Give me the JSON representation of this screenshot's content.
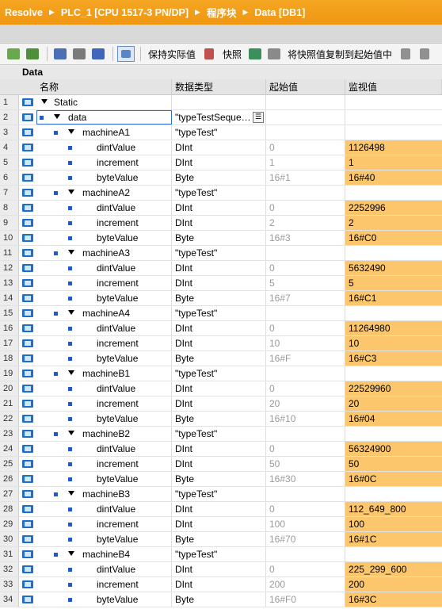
{
  "breadcrumb": [
    "Resolve",
    "PLC_1 [CPU 1517-3 PN/DP]",
    "程序块",
    "Data [DB1]"
  ],
  "toolbar": {
    "keep_actual": "保持实际值",
    "snapshot": "快照",
    "copy_snapshot": "将快照值复制到起始值中"
  },
  "block_title": "Data",
  "columns": {
    "name": "名称",
    "type": "数据类型",
    "start": "起始值",
    "monitor": "监视值"
  },
  "rows": [
    {
      "n": "1",
      "name": "Static",
      "type": "",
      "start": "",
      "monitor": ""
    },
    {
      "n": "2",
      "name": "data",
      "type": "\"typeTestSeque…",
      "start": "",
      "monitor": ""
    },
    {
      "n": "3",
      "name": "machineA1",
      "type": "\"typeTest\"",
      "start": "",
      "monitor": ""
    },
    {
      "n": "4",
      "name": "dintValue",
      "type": "DInt",
      "start": "0",
      "monitor": "1126498"
    },
    {
      "n": "5",
      "name": "increment",
      "type": "DInt",
      "start": "1",
      "monitor": "1"
    },
    {
      "n": "6",
      "name": "byteValue",
      "type": "Byte",
      "start": "16#1",
      "monitor": "16#40"
    },
    {
      "n": "7",
      "name": "machineA2",
      "type": "\"typeTest\"",
      "start": "",
      "monitor": ""
    },
    {
      "n": "8",
      "name": "dintValue",
      "type": "DInt",
      "start": "0",
      "monitor": "2252996"
    },
    {
      "n": "9",
      "name": "increment",
      "type": "DInt",
      "start": "2",
      "monitor": "2"
    },
    {
      "n": "10",
      "name": "byteValue",
      "type": "Byte",
      "start": "16#3",
      "monitor": "16#C0"
    },
    {
      "n": "11",
      "name": "machineA3",
      "type": "\"typeTest\"",
      "start": "",
      "monitor": ""
    },
    {
      "n": "12",
      "name": "dintValue",
      "type": "DInt",
      "start": "0",
      "monitor": "5632490"
    },
    {
      "n": "13",
      "name": "increment",
      "type": "DInt",
      "start": "5",
      "monitor": "5"
    },
    {
      "n": "14",
      "name": "byteValue",
      "type": "Byte",
      "start": "16#7",
      "monitor": "16#C1"
    },
    {
      "n": "15",
      "name": "machineA4",
      "type": "\"typeTest\"",
      "start": "",
      "monitor": ""
    },
    {
      "n": "16",
      "name": "dintValue",
      "type": "DInt",
      "start": "0",
      "monitor": "11264980"
    },
    {
      "n": "17",
      "name": "increment",
      "type": "DInt",
      "start": "10",
      "monitor": "10"
    },
    {
      "n": "18",
      "name": "byteValue",
      "type": "Byte",
      "start": "16#F",
      "monitor": "16#C3"
    },
    {
      "n": "19",
      "name": "machineB1",
      "type": "\"typeTest\"",
      "start": "",
      "monitor": ""
    },
    {
      "n": "20",
      "name": "dintValue",
      "type": "DInt",
      "start": "0",
      "monitor": "22529960"
    },
    {
      "n": "21",
      "name": "increment",
      "type": "DInt",
      "start": "20",
      "monitor": "20"
    },
    {
      "n": "22",
      "name": "byteValue",
      "type": "Byte",
      "start": "16#10",
      "monitor": "16#04"
    },
    {
      "n": "23",
      "name": "machineB2",
      "type": "\"typeTest\"",
      "start": "",
      "monitor": ""
    },
    {
      "n": "24",
      "name": "dintValue",
      "type": "DInt",
      "start": "0",
      "monitor": "56324900"
    },
    {
      "n": "25",
      "name": "increment",
      "type": "DInt",
      "start": "50",
      "monitor": "50"
    },
    {
      "n": "26",
      "name": "byteValue",
      "type": "Byte",
      "start": "16#30",
      "monitor": "16#0C"
    },
    {
      "n": "27",
      "name": "machineB3",
      "type": "\"typeTest\"",
      "start": "",
      "monitor": ""
    },
    {
      "n": "28",
      "name": "dintValue",
      "type": "DInt",
      "start": "0",
      "monitor": "112_649_800"
    },
    {
      "n": "29",
      "name": "increment",
      "type": "DInt",
      "start": "100",
      "monitor": "100"
    },
    {
      "n": "30",
      "name": "byteValue",
      "type": "Byte",
      "start": "16#70",
      "monitor": "16#1C"
    },
    {
      "n": "31",
      "name": "machineB4",
      "type": "\"typeTest\"",
      "start": "",
      "monitor": ""
    },
    {
      "n": "32",
      "name": "dintValue",
      "type": "DInt",
      "start": "0",
      "monitor": "225_299_600"
    },
    {
      "n": "33",
      "name": "increment",
      "type": "DInt",
      "start": "200",
      "monitor": "200"
    },
    {
      "n": "34",
      "name": "byteValue",
      "type": "Byte",
      "start": "16#F0",
      "monitor": "16#3C"
    }
  ],
  "colors": {
    "title_bar": "#f39c12",
    "monitor_cell": "#fbc66c",
    "db_icon": "#1f6fc8"
  }
}
